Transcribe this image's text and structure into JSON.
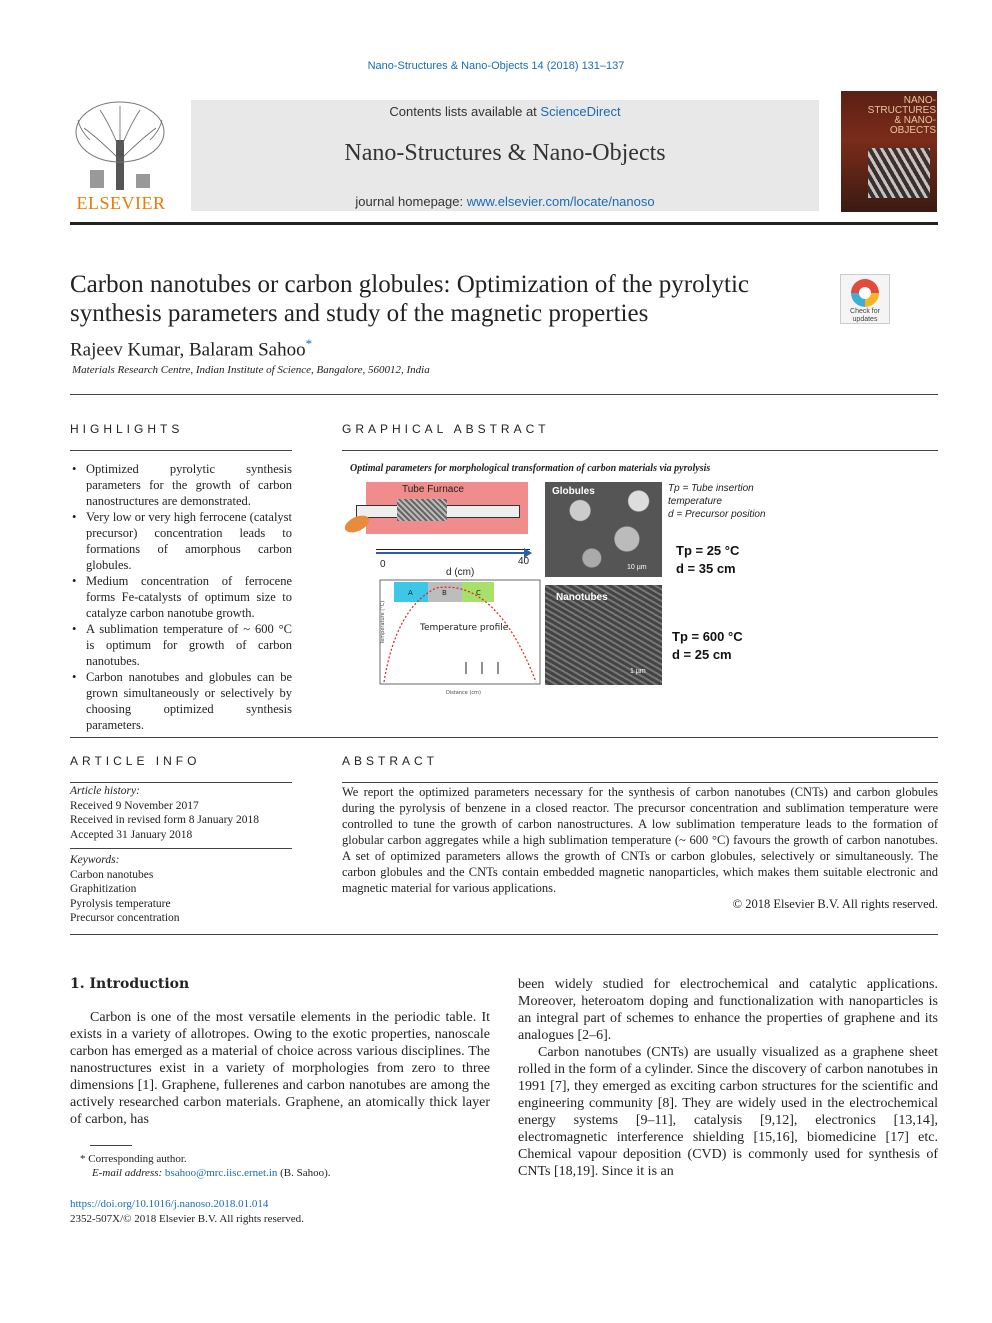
{
  "header": {
    "journal_ref": "Nano-Structures & Nano-Objects 14 (2018) 131–137",
    "publisher": "ELSEVIER",
    "contents_prefix": "Contents lists available at ",
    "contents_link": "ScienceDirect",
    "journal_name": "Nano-Structures & Nano-Objects",
    "homepage_prefix": "journal homepage: ",
    "homepage_link": "www.elsevier.com/locate/nanoso",
    "cover_title": "NANO- STRUCTURES & NANO- OBJECTS"
  },
  "article": {
    "title": "Carbon nanotubes or carbon globules: Optimization of the pyrolytic synthesis parameters and study of the magnetic properties",
    "authors": "Rajeev Kumar, Balaram Sahoo",
    "author_mark": "*",
    "affiliation": "Materials Research Centre, Indian Institute of Science, Bangalore, 560012, India",
    "crossmark_label": "Check for updates"
  },
  "highlights": {
    "heading": "HIGHLIGHTS",
    "items": [
      "Optimized pyrolytic synthesis parameters for the growth of carbon nanostructures are demonstrated.",
      "Very low or very high ferrocene (catalyst precursor) concentration leads to formations of amorphous carbon globules.",
      "Medium concentration of ferrocene forms Fe-catalysts of optimum size to catalyze carbon nanotube growth.",
      "A sublimation temperature of ~ 600 °C is optimum for growth of carbon nanotubes.",
      "Carbon nanotubes and globules can be grown simultaneously or selectively by choosing optimized synthesis parameters."
    ]
  },
  "graphical_abstract": {
    "heading": "GRAPHICAL ABSTRACT",
    "title": "Optimal parameters for morphological transformation of carbon materials via pyrolysis",
    "furnace_label": "Tube Furnace",
    "ruler_start": "0",
    "ruler_end": "40",
    "ruler_label": "d (cm)",
    "plot_label": "Temperature profile",
    "plot_ylabel": "Temperature (°C)",
    "plot_xlabel": "Distance (cm)",
    "zones": [
      "A",
      "B",
      "C"
    ],
    "img1_label": "Globules",
    "img1_scale": "10 µm",
    "img2_label": "Nanotubes",
    "img2_scale": "1 µm",
    "note_tp": "Tp = Tube insertion temperature",
    "note_d": "d = Precursor position",
    "cond1_tp": "Tp = 25 °C",
    "cond1_d": "d = 35 cm",
    "cond2_tp": "Tp = 600 °C",
    "cond2_d": "d = 25 cm"
  },
  "article_info": {
    "heading": "ARTICLE INFO",
    "history_label": "Article history:",
    "received": "Received 9 November 2017",
    "revised": "Received in revised form 8 January 2018",
    "accepted": "Accepted 31 January 2018",
    "keywords_label": "Keywords:",
    "keywords": [
      "Carbon nanotubes",
      "Graphitization",
      "Pyrolysis temperature",
      "Precursor concentration"
    ]
  },
  "abstract": {
    "heading": "ABSTRACT",
    "text": "We report the optimized parameters necessary for the synthesis of carbon nanotubes (CNTs) and carbon globules during the pyrolysis of benzene in a closed reactor. The precursor concentration and sublimation temperature were controlled to tune the growth of carbon nanostructures. A low sublimation temperature leads to the formation of globular carbon aggregates while a high sublimation temperature (~ 600 °C) favours the growth of carbon nanotubes. A set of optimized parameters allows the growth of CNTs or carbon globules, selectively or simultaneously. The carbon globules and the CNTs contain embedded magnetic nanoparticles, which makes them suitable electronic and magnetic material for various applications.",
    "copyright": "© 2018 Elsevier B.V. All rights reserved."
  },
  "introduction": {
    "title": "1. Introduction",
    "left_text": "Carbon is one of the most versatile elements in the periodic table. It exists in a variety of allotropes. Owing to the exotic properties, nanoscale carbon has emerged as a material of choice across various disciplines. The nanostructures exist in a variety of morphologies from zero to three dimensions [1]. Graphene, fullerenes and carbon nanotubes are among the actively researched carbon materials. Graphene, an atomically thick layer of carbon, has",
    "right_p1": "been widely studied for electrochemical and catalytic applications. Moreover, heteroatom doping and functionalization with nanoparticles is an integral part of schemes to enhance the properties of graphene and its analogues [2–6].",
    "right_p2": "Carbon nanotubes (CNTs) are usually visualized as a graphene sheet rolled in the form of a cylinder. Since the discovery of carbon nanotubes in 1991 [7], they emerged as exciting carbon structures for the scientific and engineering community [8]. They are widely used in the electrochemical energy systems [9–11], catalysis [9,12], electronics [13,14], electromagnetic interference shielding [15,16], biomedicine [17] etc. Chemical vapour deposition (CVD) is commonly used for synthesis of CNTs [18,19]. Since it is an"
  },
  "footer": {
    "corr_mark": "*",
    "corr_label": "Corresponding author.",
    "email_label": "E-mail address:",
    "email": "bsahoo@mrc.iisc.ernet.in",
    "email_suffix": " (B. Sahoo).",
    "doi": "https://doi.org/10.1016/j.nanoso.2018.01.014",
    "issn": "2352-507X/© 2018 Elsevier B.V. All rights reserved."
  }
}
